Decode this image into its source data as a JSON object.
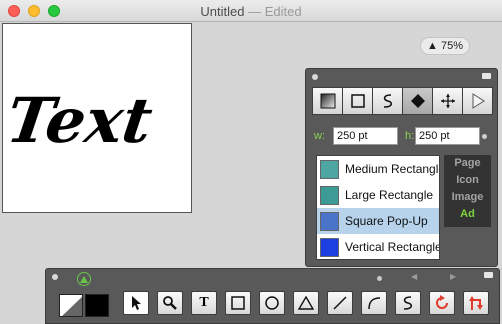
{
  "window": {
    "title": "Untitled",
    "separator": "—",
    "status": "Edited"
  },
  "canvas": {
    "text": "Text"
  },
  "zoom": {
    "label": "▲ 75%"
  },
  "palette": {
    "shape_buttons": [
      {
        "icon": "gradient-icon"
      },
      {
        "icon": "square-icon"
      },
      {
        "icon": "path-icon"
      },
      {
        "icon": "diamond-icon",
        "selected": true
      },
      {
        "icon": "move-icon"
      },
      {
        "icon": "play-icon"
      }
    ],
    "width_label": "w:",
    "width_value": "250 pt",
    "height_label": "h:",
    "height_value": "250 pt",
    "items": [
      {
        "label": "Medium Rectangle",
        "color": "#4ea6a3"
      },
      {
        "label": "Large Rectangle",
        "color": "#3c9c95"
      },
      {
        "label": "Square Pop-Up",
        "color": "#4a74c9",
        "selected": true
      },
      {
        "label": "Vertical Rectangle",
        "color": "#1b3fe0"
      }
    ],
    "categories": [
      {
        "label": "Page"
      },
      {
        "label": "Icon"
      },
      {
        "label": "Image"
      },
      {
        "label": "Ad",
        "active": true
      }
    ]
  },
  "toolbar": {
    "stroke_color": "#ffffff",
    "fill_color": "#000000",
    "tools": [
      {
        "icon": "pointer-icon",
        "selected": true
      },
      {
        "icon": "zoom-icon"
      },
      {
        "icon": "text-icon",
        "glyph": "T"
      },
      {
        "icon": "rectangle-icon"
      },
      {
        "icon": "ellipse-icon"
      },
      {
        "icon": "triangle-icon"
      },
      {
        "icon": "line-icon"
      },
      {
        "icon": "arc-icon"
      },
      {
        "icon": "bezier-icon"
      },
      {
        "icon": "rotate-icon"
      },
      {
        "icon": "transform-icon"
      }
    ]
  },
  "colors": {
    "accent_green": "#7ed43e",
    "selection_blue": "#b7d3ec",
    "palette_bg": "#595959"
  }
}
